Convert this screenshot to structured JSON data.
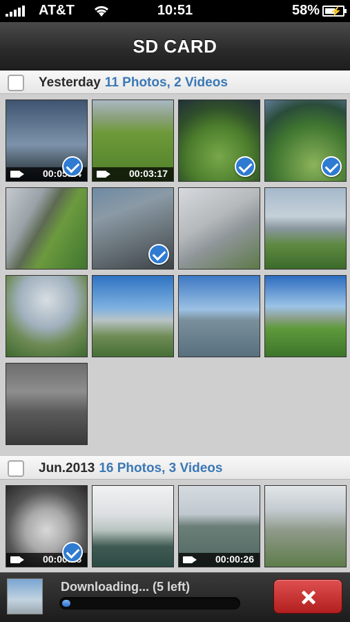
{
  "status_bar": {
    "carrier": "AT&T",
    "time": "10:51",
    "battery": "58%"
  },
  "nav": {
    "title": "SD CARD"
  },
  "sections": [
    {
      "date": "Yesterday",
      "count": "11 Photos, 2 Videos",
      "items": [
        {
          "scene": "sky-dusk",
          "video": true,
          "duration": "00:05:14",
          "selected": true
        },
        {
          "scene": "grass",
          "video": true,
          "duration": "00:03:17",
          "selected": false
        },
        {
          "scene": "fisheye",
          "video": false,
          "selected": true
        },
        {
          "scene": "fisheye2",
          "video": false,
          "selected": true
        },
        {
          "scene": "walkway",
          "video": false,
          "selected": false
        },
        {
          "scene": "stairs",
          "video": false,
          "selected": true
        },
        {
          "scene": "pier",
          "video": false,
          "selected": false
        },
        {
          "scene": "coast",
          "video": false,
          "selected": false
        },
        {
          "scene": "aerial",
          "video": false,
          "selected": false
        },
        {
          "scene": "sky-bright",
          "video": false,
          "selected": false
        },
        {
          "scene": "sea",
          "video": false,
          "selected": false
        },
        {
          "scene": "field",
          "video": false,
          "selected": false
        },
        {
          "scene": "indoor",
          "video": false,
          "selected": false
        }
      ]
    },
    {
      "date": "Jun.2013",
      "count": "16 Photos, 3 Videos",
      "items": [
        {
          "scene": "group",
          "video": true,
          "duration": "00:00:25",
          "selected": true
        },
        {
          "scene": "boat",
          "video": false,
          "selected": false
        },
        {
          "scene": "bay",
          "video": true,
          "duration": "00:00:26",
          "selected": false
        },
        {
          "scene": "city",
          "video": false,
          "selected": false
        }
      ]
    }
  ],
  "download": {
    "status": "Downloading... (5 left)",
    "progress": 0.04
  },
  "colors": {
    "accent": "#3b78b5",
    "check": "#2f7bd1",
    "cancel": "#c62b2b"
  }
}
